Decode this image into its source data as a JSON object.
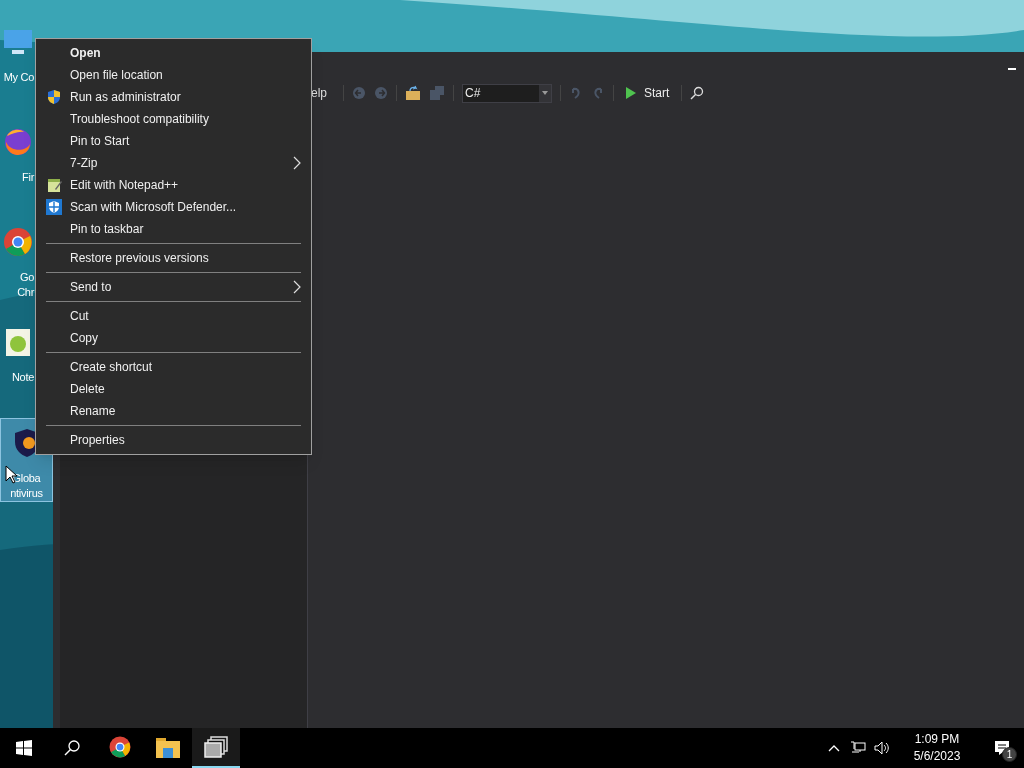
{
  "desktop_icons": [
    {
      "lines": [
        "My Co"
      ],
      "kind": "computer",
      "selected": false
    },
    {
      "lines": [
        "Fir"
      ],
      "kind": "firefox",
      "selected": false
    },
    {
      "lines": [
        "Go",
        "Chr"
      ],
      "kind": "chrome",
      "selected": false
    },
    {
      "lines": [
        "Note"
      ],
      "kind": "notepad",
      "selected": false
    },
    {
      "lines": [
        "Globa",
        "ntivirus"
      ],
      "kind": "shield",
      "selected": true
    }
  ],
  "app_window": {
    "toolbar": {
      "menu_fragment": "elp",
      "language": "C#",
      "start": "Start",
      "back_enabled": false,
      "save_enabled": false,
      "undo_enabled": false
    }
  },
  "context_menu": [
    {
      "kind": "item",
      "label": "Open",
      "default": true,
      "submenu": false
    },
    {
      "kind": "item",
      "label": "Open file location",
      "default": false,
      "submenu": false
    },
    {
      "kind": "admin",
      "label": "Run as administrator",
      "default": false,
      "submenu": false
    },
    {
      "kind": "item",
      "label": "Troubleshoot compatibility",
      "default": false,
      "submenu": false
    },
    {
      "kind": "item",
      "label": "Pin to Start",
      "default": false,
      "submenu": false
    },
    {
      "kind": "item",
      "label": "7-Zip",
      "default": false,
      "submenu": true
    },
    {
      "kind": "notepad",
      "label": "Edit with Notepad++",
      "default": false,
      "submenu": false
    },
    {
      "kind": "defender",
      "label": "Scan with Microsoft Defender...",
      "default": false,
      "submenu": false
    },
    {
      "kind": "item",
      "label": "Pin to taskbar",
      "default": false,
      "submenu": false
    },
    {
      "kind": "separator"
    },
    {
      "kind": "item",
      "label": "Restore previous versions",
      "default": false,
      "submenu": false
    },
    {
      "kind": "separator"
    },
    {
      "kind": "item",
      "label": "Send to",
      "default": false,
      "submenu": true
    },
    {
      "kind": "separator"
    },
    {
      "kind": "item",
      "label": "Cut",
      "default": false,
      "submenu": false
    },
    {
      "kind": "item",
      "label": "Copy",
      "default": false,
      "submenu": false
    },
    {
      "kind": "separator"
    },
    {
      "kind": "item",
      "label": "Create shortcut",
      "default": false,
      "submenu": false
    },
    {
      "kind": "item",
      "label": "Delete",
      "default": false,
      "submenu": false
    },
    {
      "kind": "item",
      "label": "Rename",
      "default": false,
      "submenu": false
    },
    {
      "kind": "separator"
    },
    {
      "kind": "item",
      "label": "Properties",
      "default": false,
      "submenu": false
    }
  ],
  "taskbar": {
    "apps": [
      {
        "kind": "chrome",
        "active": false
      },
      {
        "kind": "folder",
        "active": false
      },
      {
        "kind": "taskview",
        "active": true
      }
    ],
    "time": "1:09 PM",
    "date": "5/6/2023",
    "notifications": "1"
  }
}
